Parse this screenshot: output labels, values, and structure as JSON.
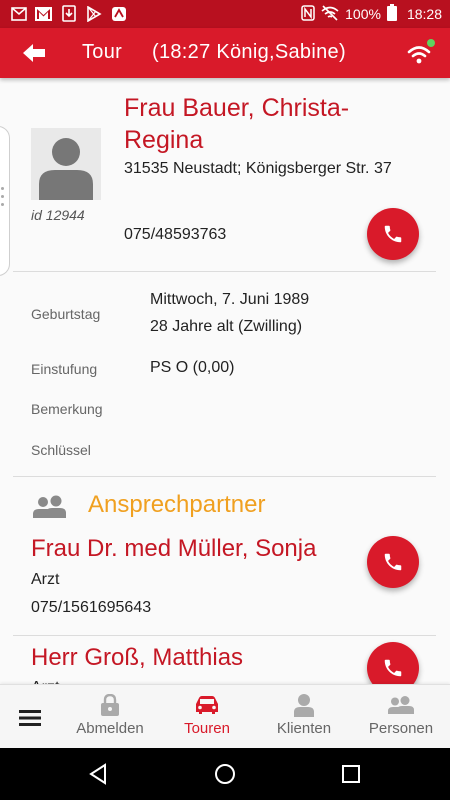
{
  "status_bar": {
    "battery": "100%",
    "time": "18:28",
    "icons": [
      "mail-icon",
      "gmail-icon",
      "download-icon",
      "play-store-icon",
      "app-icon",
      "nfc-icon",
      "wifi-off-icon",
      "battery-icon"
    ]
  },
  "app_bar": {
    "title": "Tour",
    "subtitle": "(18:27 König,Sabine)",
    "color": "#d91a2a",
    "wifi_status_color": "#5fd35f"
  },
  "client": {
    "name": "Frau Bauer, Christa-Regina",
    "id": "id 12944",
    "address": "31535 Neustadt; Königsberger Str. 37",
    "phone": "075/48593763"
  },
  "details": {
    "birthday_label": "Geburtstag",
    "birthday_value": "Mittwoch, 7. Juni 1989",
    "age_value": "28 Jahre alt (Zwilling)",
    "classification_label": "Einstufung",
    "classification_value": "PS O (0,00)",
    "remark_label": "Bemerkung",
    "key_label": "Schlüssel"
  },
  "contacts_section": {
    "title": "Ansprechpartner",
    "title_color": "#f0a020",
    "contacts": [
      {
        "name": "Frau Dr. med Müller, Sonja",
        "role": "Arzt",
        "phone": "075/1561695643"
      },
      {
        "name": "Herr Groß, Matthias",
        "role": "Arzt"
      }
    ]
  },
  "bottom_nav": {
    "items": [
      {
        "label": "Abmelden",
        "icon": "lock-icon"
      },
      {
        "label": "Touren",
        "icon": "car-icon",
        "active": true
      },
      {
        "label": "Klienten",
        "icon": "person-icon"
      },
      {
        "label": "Personen",
        "icon": "people-icon"
      }
    ]
  }
}
